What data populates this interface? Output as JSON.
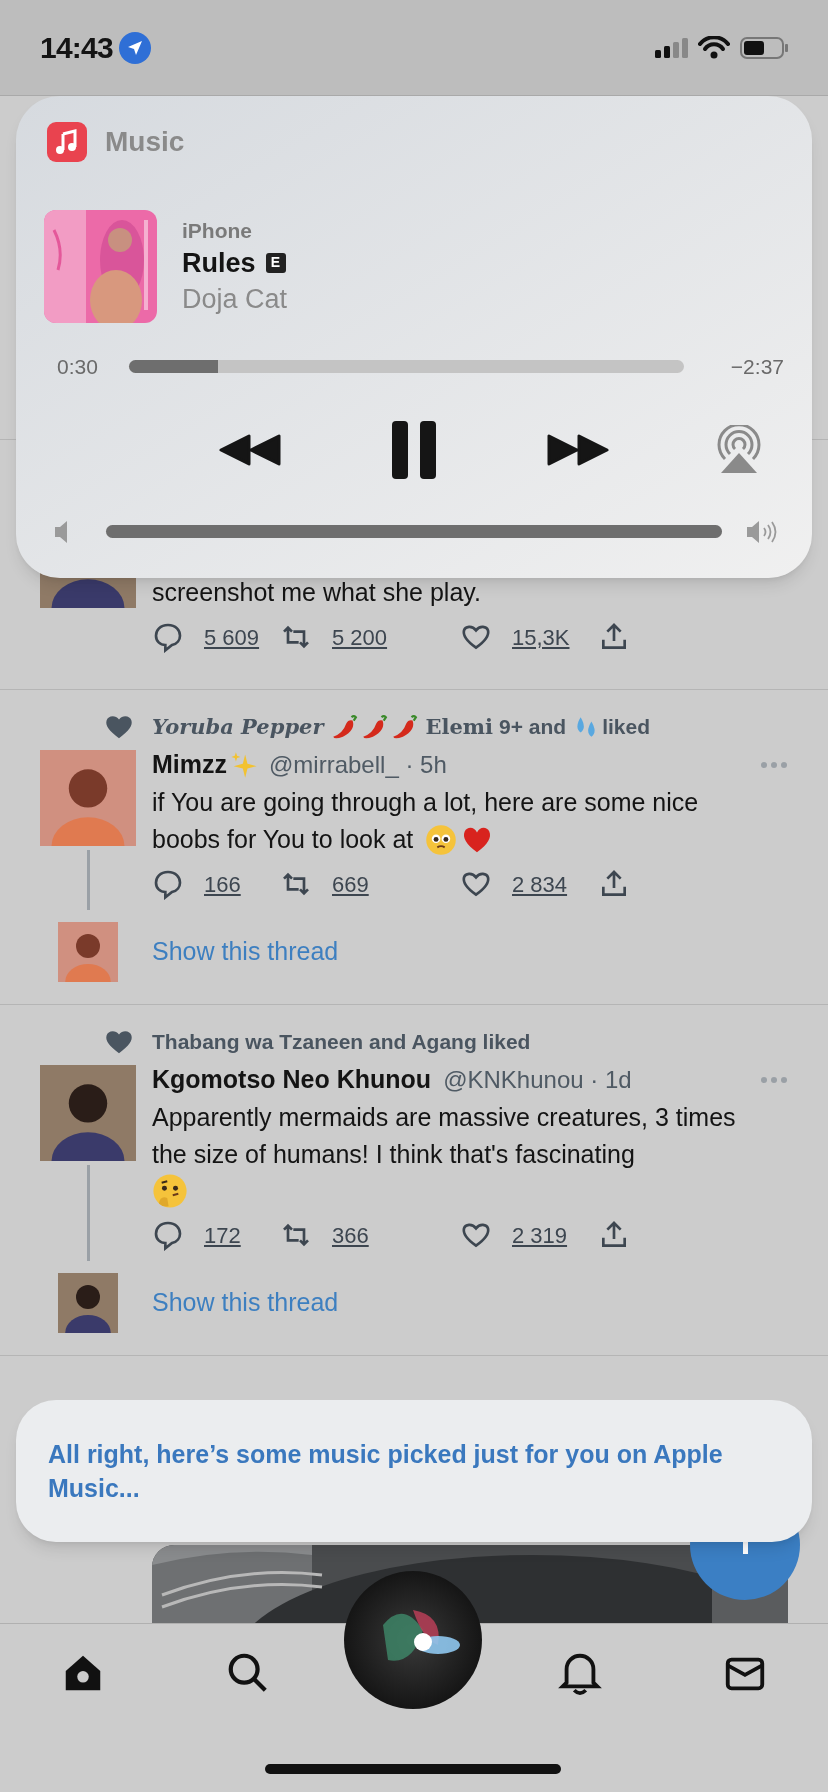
{
  "status_bar": {
    "time": "14:43"
  },
  "now_playing": {
    "app": "Music",
    "device": "iPhone",
    "title": "Rules",
    "explicit_badge": "E",
    "artist": "Doja Cat",
    "elapsed": "0:30",
    "remaining": "−2:37",
    "progress": {
      "level": 0.16
    },
    "playing": true,
    "volume": {
      "level": 1.0
    }
  },
  "tweets": [
    {
      "text_parts": [
        {
          "kind": "text",
          "text": "screenshot me what she play."
        }
      ],
      "replies": "5 609",
      "retweets": "5 200",
      "likes": "15,3K"
    },
    {
      "liked_by": [
        {
          "kind": "script",
          "text": "Yoruba Pepper"
        },
        {
          "kind": "chili"
        },
        {
          "kind": "chili"
        },
        {
          "kind": "chili"
        },
        {
          "kind": "fraktur",
          "text": "Elemi"
        },
        {
          "kind": "text",
          "text": "9+ and"
        },
        {
          "kind": "droplets"
        },
        {
          "kind": "text",
          "text": "liked"
        }
      ],
      "author": [
        {
          "kind": "name",
          "text": "Mimzz"
        },
        {
          "kind": "sparkles"
        },
        {
          "kind": "meta",
          "text": "@mirrabell_ · 5h"
        }
      ],
      "text_parts": [
        {
          "kind": "text",
          "text": "if You are going through a lot, here are some nice"
        },
        {
          "kind": "text",
          "text": "boobs for You to look at"
        },
        {
          "kind": "pleading"
        },
        {
          "kind": "heart"
        }
      ],
      "replies": "166",
      "retweets": "669",
      "likes": "2 834",
      "thread_link": "Show this thread"
    },
    {
      "liked_by": [
        {
          "kind": "text",
          "text": "Thabang wa Tzaneen and Agang liked"
        }
      ],
      "author": [
        {
          "kind": "name",
          "text": "Kgomotso Neo Khunou"
        },
        {
          "kind": "meta",
          "text": "@KNKhunou · 1d"
        }
      ],
      "text_parts": [
        {
          "kind": "text",
          "text": "Apparently mermaids are massive creatures, 3 times the size of humans! I think that's fascinating"
        },
        {
          "kind": "thinking"
        }
      ],
      "replies": "172",
      "retweets": "366",
      "likes": "2 319",
      "thread_link": "Show this thread"
    },
    {
      "media": {
        "kind": "picture"
      }
    }
  ],
  "siri": {
    "response": "All right, here’s some music picked just for you on Apple Music..."
  },
  "tab_bar": {
    "items": [
      {
        "kind": "home",
        "selected": true
      },
      {
        "kind": "search",
        "selected": false
      },
      {
        "kind": "bell",
        "selected": false
      },
      {
        "kind": "mail",
        "selected": false
      }
    ]
  }
}
